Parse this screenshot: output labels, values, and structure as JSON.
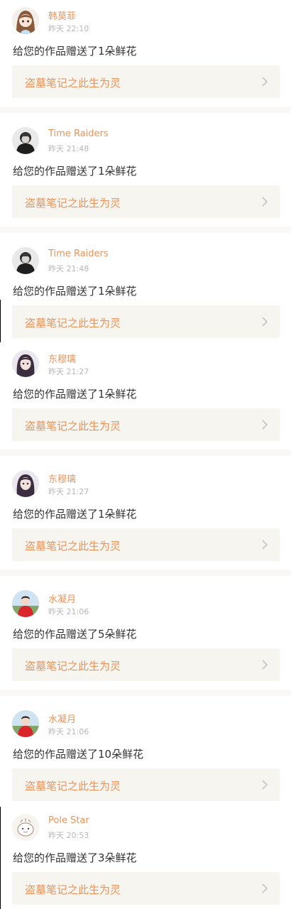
{
  "feed": {
    "items": [
      {
        "username": "韩莫菲",
        "time": "昨天 22:10",
        "message": "给您的作品赠送了1朵鲜花",
        "work_title": "盗墓笔记之此生为灵",
        "avatar_icon": "anime-girl-avatar-icon"
      },
      {
        "username": "Time Raiders",
        "time": "昨天 21:48",
        "message": "给您的作品赠送了1朵鲜花",
        "work_title": "盗墓笔记之此生为灵",
        "avatar_icon": "dark-figure-avatar-icon"
      },
      {
        "username": "Time Raiders",
        "time": "昨天 21:48",
        "message": "给您的作品赠送了1朵鲜花",
        "work_title": "盗墓笔记之此生为灵",
        "avatar_icon": "dark-figure-avatar-icon"
      },
      {
        "username": "东穆璃",
        "time": "昨天 21:27",
        "message": "给您的作品赠送了1朵鲜花",
        "work_title": "盗墓笔记之此生为灵",
        "avatar_icon": "long-hair-girl-avatar-icon"
      },
      {
        "username": "东穆璃",
        "time": "昨天 21:27",
        "message": "给您的作品赠送了1朵鲜花",
        "work_title": "盗墓笔记之此生为灵",
        "avatar_icon": "long-hair-girl-avatar-icon"
      },
      {
        "username": "水凝月",
        "time": "昨天 21:06",
        "message": "给您的作品赠送了5朵鲜花",
        "work_title": "盗墓笔记之此生为灵",
        "avatar_icon": "red-dress-girl-avatar-icon"
      },
      {
        "username": "水凝月",
        "time": "昨天 21:06",
        "message": "给您的作品赠送了10朵鲜花",
        "work_title": "盗墓笔记之此生为灵",
        "avatar_icon": "red-dress-girl-avatar-icon"
      },
      {
        "username": "Pole Star",
        "time": "昨天 20:53",
        "message": "给您的作品赠送了3朵鲜花",
        "work_title": "盗墓笔记之此生为灵",
        "avatar_icon": "cartoon-doodle-avatar-icon"
      }
    ]
  },
  "colors": {
    "username": "#e8945c",
    "work_title": "#e8945c",
    "message": "#333333",
    "time": "#b8b8b8",
    "work_link_bg": "#f6f5ef",
    "separator": "#faf7f7"
  }
}
